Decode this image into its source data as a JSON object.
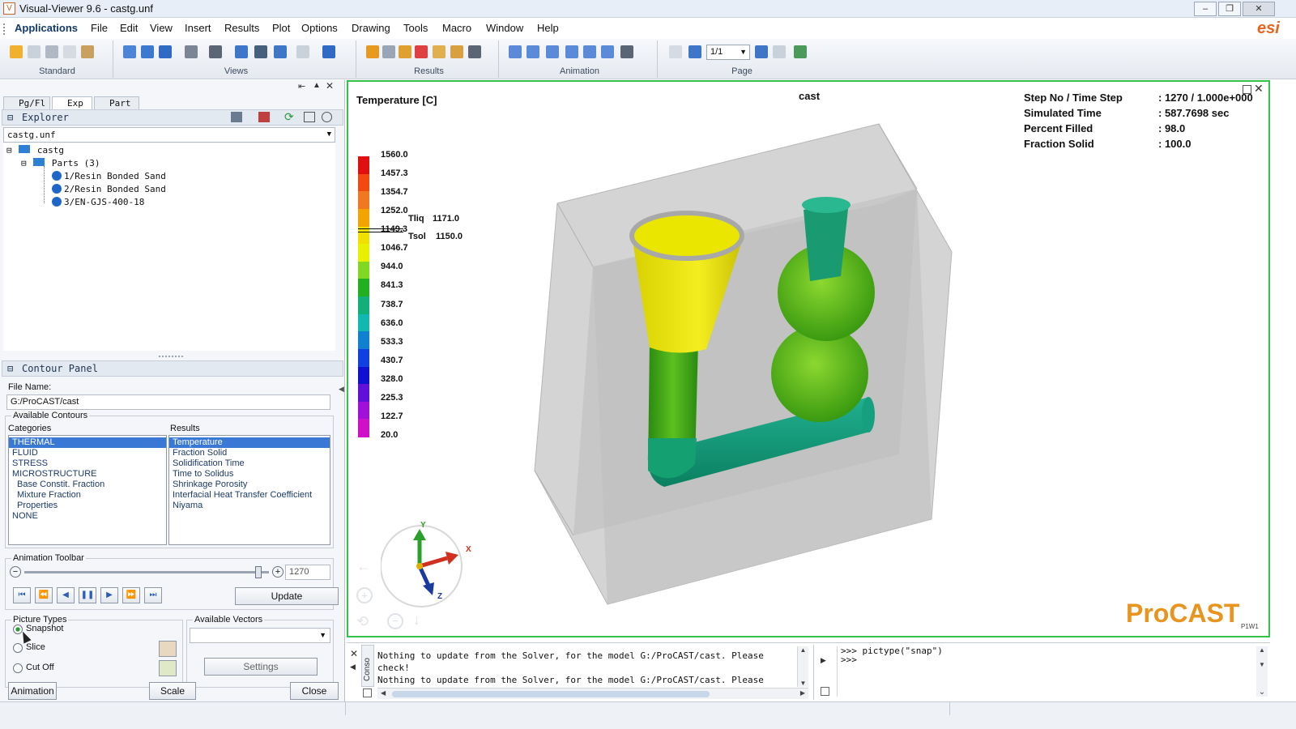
{
  "window": {
    "title": "Visual-Viewer 9.6 - castg.unf",
    "controls": [
      "–",
      "❐",
      "✕"
    ]
  },
  "menu": [
    "Applications",
    "File",
    "Edit",
    "View",
    "Insert",
    "Results",
    "Plot",
    "Options",
    "Drawing",
    "Tools",
    "Macro",
    "Window",
    "Help"
  ],
  "brand_logo": "esi",
  "toolbar": {
    "groups": [
      "Standard",
      "Views",
      "Results",
      "Animation",
      "Page"
    ],
    "page_value": "1/1"
  },
  "left": {
    "tabs": [
      "Pg/Fl",
      "Exp",
      "Part"
    ],
    "explorer": {
      "title": "Explorer",
      "file": "castg.unf",
      "root": "castg",
      "parts_label": "Parts (3)",
      "parts": [
        "1/Resin Bonded Sand",
        "2/Resin Bonded Sand",
        "3/EN-GJS-400-18"
      ]
    },
    "contour": {
      "title": "Contour Panel",
      "file_name_label": "File Name:",
      "file_name": "G:/ProCAST/cast",
      "available_label": "Available Contours",
      "categories_label": "Categories",
      "results_label": "Results",
      "categories": [
        "THERMAL",
        "FLUID",
        "STRESS",
        "MICROSTRUCTURE",
        "Base Constit. Fraction",
        "Mixture Fraction",
        "Properties",
        "NONE"
      ],
      "results": [
        "Temperature",
        "Fraction Solid",
        "Solidification Time",
        "Time to Solidus",
        "Shrinkage Porosity",
        "Interfacial Heat Transfer Coefficient",
        "Niyama"
      ],
      "anim_label": "Animation Toolbar",
      "step_value": "1270",
      "slider_fraction": 0.97,
      "update_label": "Update",
      "picture_types_label": "Picture Types",
      "picture_types": [
        "Snapshot",
        "Slice",
        "Cut Off"
      ],
      "vectors_label": "Available Vectors",
      "settings_label": "Settings",
      "bottom_buttons": [
        "Animation",
        "Scale",
        "Close"
      ]
    }
  },
  "viewer": {
    "legend_title": "Temperature  [C]",
    "model_title": "cast",
    "scale": [
      "1560.0",
      "1457.3",
      "1354.7",
      "1252.0",
      "1149.3",
      "1046.7",
      "944.0",
      "841.3",
      "738.7",
      "636.0",
      "533.3",
      "430.7",
      "328.0",
      "225.3",
      "122.7",
      "20.0"
    ],
    "scale_colors": [
      "#e01010",
      "#f04a10",
      "#f07820",
      "#f4a400",
      "#f0e000",
      "#e8f000",
      "#80d820",
      "#20b020",
      "#10b078",
      "#10b8b0",
      "#1080d0",
      "#1040e0",
      "#1010d0",
      "#6010d8",
      "#a010d8",
      "#d010c8"
    ],
    "tliq_label": "Tliq",
    "tliq_value": "1171.0",
    "tsol_label": "Tsol",
    "tsol_value": "1150.0",
    "info": [
      {
        "label": "Step No / Time Step",
        "value": ": 1270 / 1.000e+000"
      },
      {
        "label": "Simulated Time",
        "value": ": 587.7698 sec"
      },
      {
        "label": "Percent Filled",
        "value": ": 98.0"
      },
      {
        "label": "Fraction Solid",
        "value": ": 100.0"
      }
    ],
    "axes": {
      "x": "X",
      "y": "Y",
      "z": "Z"
    },
    "logo": "ProCAST",
    "logo_sub": "P1W1"
  },
  "console": {
    "tab_label": "Conso",
    "lines": [
      "Nothing to update from the Solver, for the model G:/ProCAST/cast. Please check!",
      "Nothing to update from the Solver, for the model G:/ProCAST/cast. Please check!"
    ],
    "python_lines": [
      ">>> pictype(\"snap\")",
      ">>>"
    ]
  }
}
